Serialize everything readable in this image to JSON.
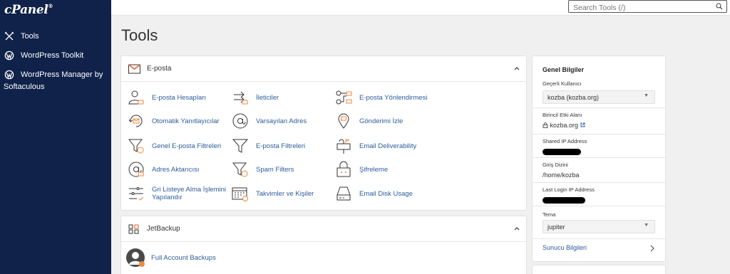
{
  "sidebar": {
    "logo": "cPanel",
    "items": [
      {
        "icon": "tools-icon",
        "label": "Tools"
      },
      {
        "icon": "wordpress-icon",
        "label": "WordPress Toolkit"
      },
      {
        "icon": "wordpress-icon",
        "label": "WordPress Manager by",
        "label2": "Softaculous"
      }
    ]
  },
  "search": {
    "placeholder": "Search Tools (/)"
  },
  "page": {
    "title": "Tools"
  },
  "email_panel": {
    "title": "E-posta",
    "tools": [
      {
        "icon": "email-accounts-icon",
        "label": "E-posta Hesapları"
      },
      {
        "icon": "forwarders-icon",
        "label": "İleticiler"
      },
      {
        "icon": "email-routing-icon",
        "label": "E-posta Yönlendirmesi"
      },
      {
        "icon": "autoresponder-icon",
        "label": "Otomatik Yanıtlayıcılar"
      },
      {
        "icon": "default-address-icon",
        "label": "Varsayılan Adres"
      },
      {
        "icon": "track-delivery-icon",
        "label": "Gönderimi İzle"
      },
      {
        "icon": "global-filter-icon",
        "label": "Genel E-posta Filtreleri"
      },
      {
        "icon": "email-filter-icon",
        "label": "E-posta Filtreleri"
      },
      {
        "icon": "deliverability-icon",
        "label": "Email Deliverability"
      },
      {
        "icon": "address-importer-icon",
        "label": "Adres Aktarıcısı"
      },
      {
        "icon": "spam-filter-icon",
        "label": "Spam Filters"
      },
      {
        "icon": "encryption-icon",
        "label": "Şifreleme"
      },
      {
        "icon": "greylisting-icon",
        "label": "Gri Listeye Alma İşlemini",
        "label2": "Yapılandır"
      },
      {
        "icon": "calendar-contacts-icon",
        "label": "Takvimler ve Kişiler"
      },
      {
        "icon": "disk-usage-icon",
        "label": "Email Disk Usage"
      }
    ]
  },
  "jetbackup_panel": {
    "title": "JetBackup",
    "tools": [
      {
        "icon": "full-backup-icon",
        "label": "Full Account Backups"
      }
    ]
  },
  "general_info": {
    "title": "Genel Bilgiler",
    "current_user_label": "Geçerli Kullanıcı",
    "current_user_value": "kozba (kozba.org)",
    "primary_domain_label": "Birincil Etki Alanı",
    "primary_domain_value": "kozba.org",
    "shared_ip_label": "Shared IP Address",
    "home_dir_label": "Giriş Dizini",
    "home_dir_value": "/home/kozba",
    "last_login_label": "Last Login IP Address",
    "theme_label": "Tema",
    "theme_value": "jupiter",
    "server_info_label": "Sunucu Bilgileri"
  },
  "colors": {
    "sidebar": "#10224a",
    "link": "#2d5c9a",
    "accent": "#f0883e"
  }
}
